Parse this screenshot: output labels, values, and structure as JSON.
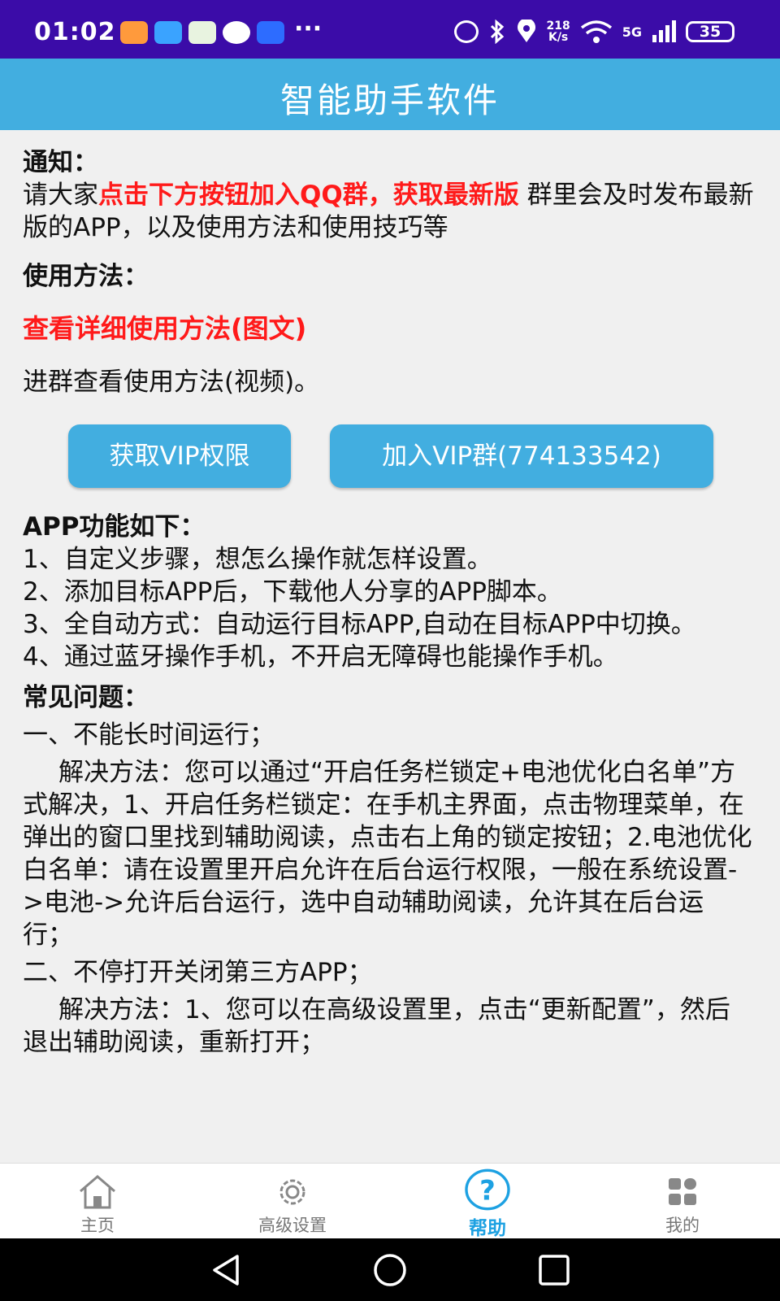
{
  "status_bar": {
    "time": "01:02",
    "more": "···",
    "net_speed_value": "218",
    "net_speed_unit": "K/s",
    "signal": "5G",
    "battery": "35"
  },
  "header": {
    "title": "智能助手软件"
  },
  "content": {
    "notice_heading": "通知：",
    "notice_prefix": "请大家",
    "notice_highlight": "点击下方按钮加入QQ群，获取最新版",
    "notice_suffix": " 群里会及时发布最新版的APP，以及使用方法和使用技巧等",
    "usage_heading": "使用方法：",
    "usage_link": "查看详细使用方法(图文)",
    "usage_video": "进群查看使用方法(视频)。",
    "btn_vip": "获取VIP权限",
    "btn_group": "加入VIP群(774133542)",
    "features_heading": "APP功能如下：",
    "features": [
      "1、自定义步骤，想怎么操作就怎样设置。",
      "2、添加目标APP后，下载他人分享的APP脚本。",
      "3、全自动方式：自动运行目标APP,自动在目标APP中切换。",
      "4、通过蓝牙操作手机，不开启无障碍也能操作手机。"
    ],
    "faq_heading": "常见问题：",
    "faq1_title": "一、不能长时间运行；",
    "faq1_solution": "解决方法：您可以通过“开启任务栏锁定+电池优化白名单”方式解决，1、开启任务栏锁定：在手机主界面，点击物理菜单，在弹出的窗口里找到辅助阅读，点击右上角的锁定按钮；2.电池优化白名单：请在设置里开启允许在后台运行权限，一般在系统设置->电池->允许后台运行，选中自动辅助阅读，允许其在后台运行；",
    "faq2_title": "二、不停打开关闭第三方APP；",
    "faq2_solution": "解决方法：1、您可以在高级设置里，点击“更新配置”，然后退出辅助阅读，重新打开；"
  },
  "bottom_nav": {
    "items": [
      {
        "label": "主页",
        "icon": "home-icon"
      },
      {
        "label": "高级设置",
        "icon": "gear-icon"
      },
      {
        "label": "帮助",
        "icon": "help-icon"
      },
      {
        "label": "我的",
        "icon": "grid-icon"
      }
    ],
    "active_index": 2,
    "active_color": "#1da1e2"
  },
  "colors": {
    "status_bar": "#3b0ca8",
    "title_bar": "#42aee0",
    "button": "#42aee0",
    "highlight_red": "#ff1a1a",
    "background": "#f0f0f0"
  }
}
